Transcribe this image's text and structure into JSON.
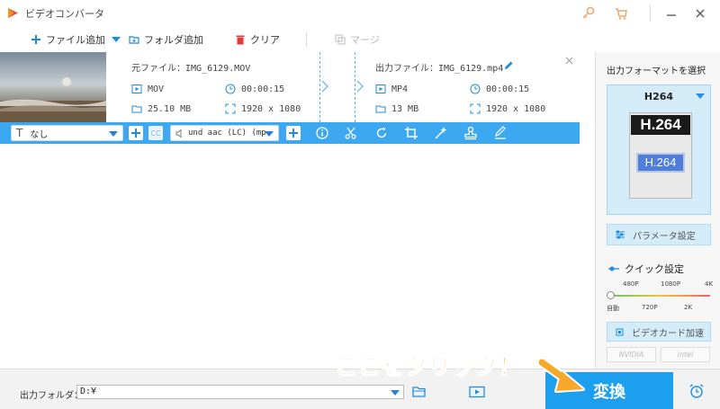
{
  "app": {
    "title": "ビデオコンバータ"
  },
  "toolbar": {
    "add_file": "ファイル追加",
    "add_folder": "フォルダ追加",
    "clear": "クリア",
    "merge": "マージ"
  },
  "file": {
    "source_label": "元ファイル：",
    "source_name": "IMG_6129.MOV",
    "source_format": "MOV",
    "source_duration": "00:00:15",
    "source_size": "25.10 MB",
    "source_resolution": "1920 x 1080",
    "output_label": "出力ファイル：",
    "output_name": "IMG_6129.mp4",
    "output_format": "MP4",
    "output_duration": "00:00:15",
    "output_size": "13 MB",
    "output_resolution": "1920 x 1080"
  },
  "editbar": {
    "subtitle_value": "なし",
    "audio_value": "und aac (LC) (mp·"
  },
  "right_panel": {
    "format_label": "出力フォーマットを選択",
    "format_name": "H264",
    "format_badge_top": "H.264",
    "format_badge_bottom": "H.264",
    "param_settings": "パラメータ設定",
    "quick_settings": "クイック設定",
    "quick_top_labels": [
      "480P",
      "1080P",
      "4K"
    ],
    "quick_bottom_labels": [
      "自動",
      "720P",
      "2K"
    ],
    "gpu_accel": "ビデオカード加速",
    "vendor_nvidia": "NVIDIA",
    "vendor_intel": "Intel"
  },
  "bottom": {
    "output_folder_label": "出力フォルダ：",
    "output_folder_value": "D:¥",
    "convert_label": "変換"
  },
  "annotation": {
    "text": "ここをクリック！"
  },
  "colors": {
    "accent": "#1d9ff0",
    "editbar": "#3ca8f1",
    "annotation": "#f7a72a"
  }
}
